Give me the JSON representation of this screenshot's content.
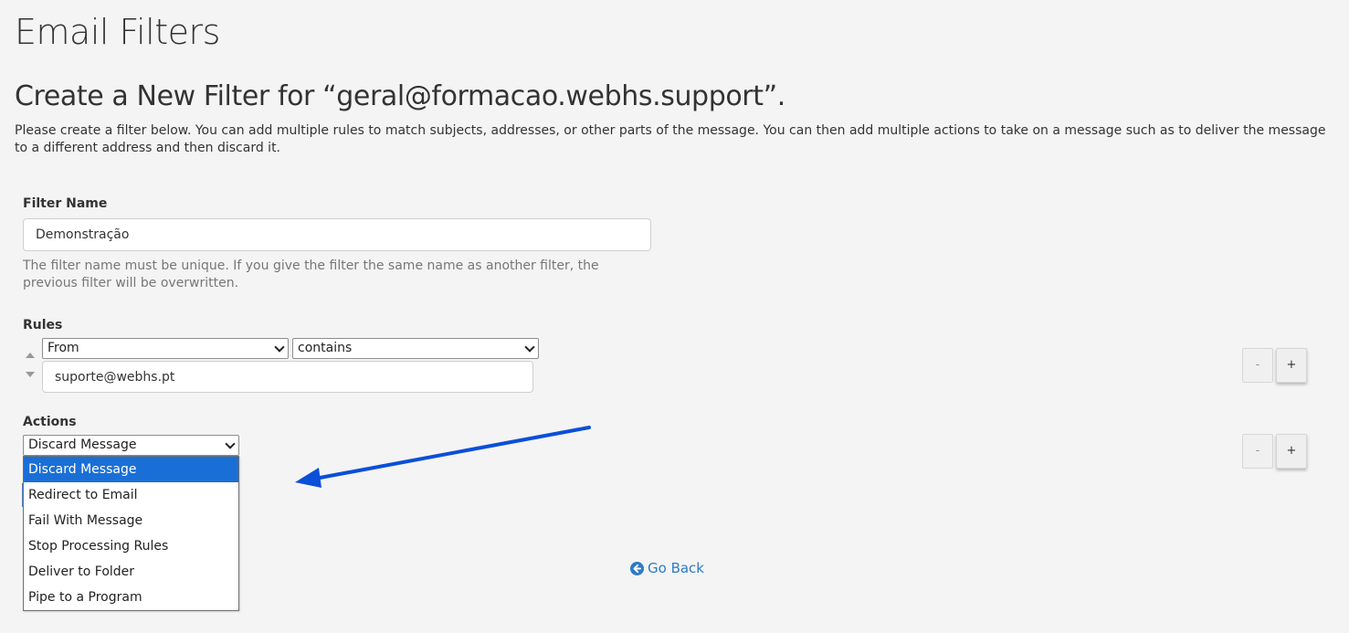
{
  "page": {
    "title": "Email Filters",
    "section_title": "Create a New Filter for “geral@formacao.webhs.support”.",
    "intro": "Please create a filter below. You can add multiple rules to match subjects, addresses, or other parts of the message. You can then add multiple actions to take on a message such as to deliver the message to a different address and then discard it."
  },
  "filter_name": {
    "label": "Filter Name",
    "value": "Demonstração",
    "help": "The filter name must be unique. If you give the filter the same name as another filter, the previous filter will be overwritten."
  },
  "rules": {
    "label": "Rules",
    "field_select": "From",
    "match_select": "contains",
    "value": "suporte@webhs.pt",
    "remove_label": "-",
    "add_label": "+"
  },
  "actions": {
    "label": "Actions",
    "selected": "Discard Message",
    "options": [
      "Discard Message",
      "Redirect to Email",
      "Fail With Message",
      "Stop Processing Rules",
      "Deliver to Folder",
      "Pipe to a Program"
    ],
    "remove_label": "-",
    "add_label": "+"
  },
  "go_back": {
    "label": "Go Back",
    "icon": "arrow-circle-left-icon"
  },
  "colors": {
    "accent": "#1a6fd6",
    "link": "#2c7bc4",
    "annotation_arrow": "#0a4fd8",
    "background": "#f4f4f5"
  }
}
